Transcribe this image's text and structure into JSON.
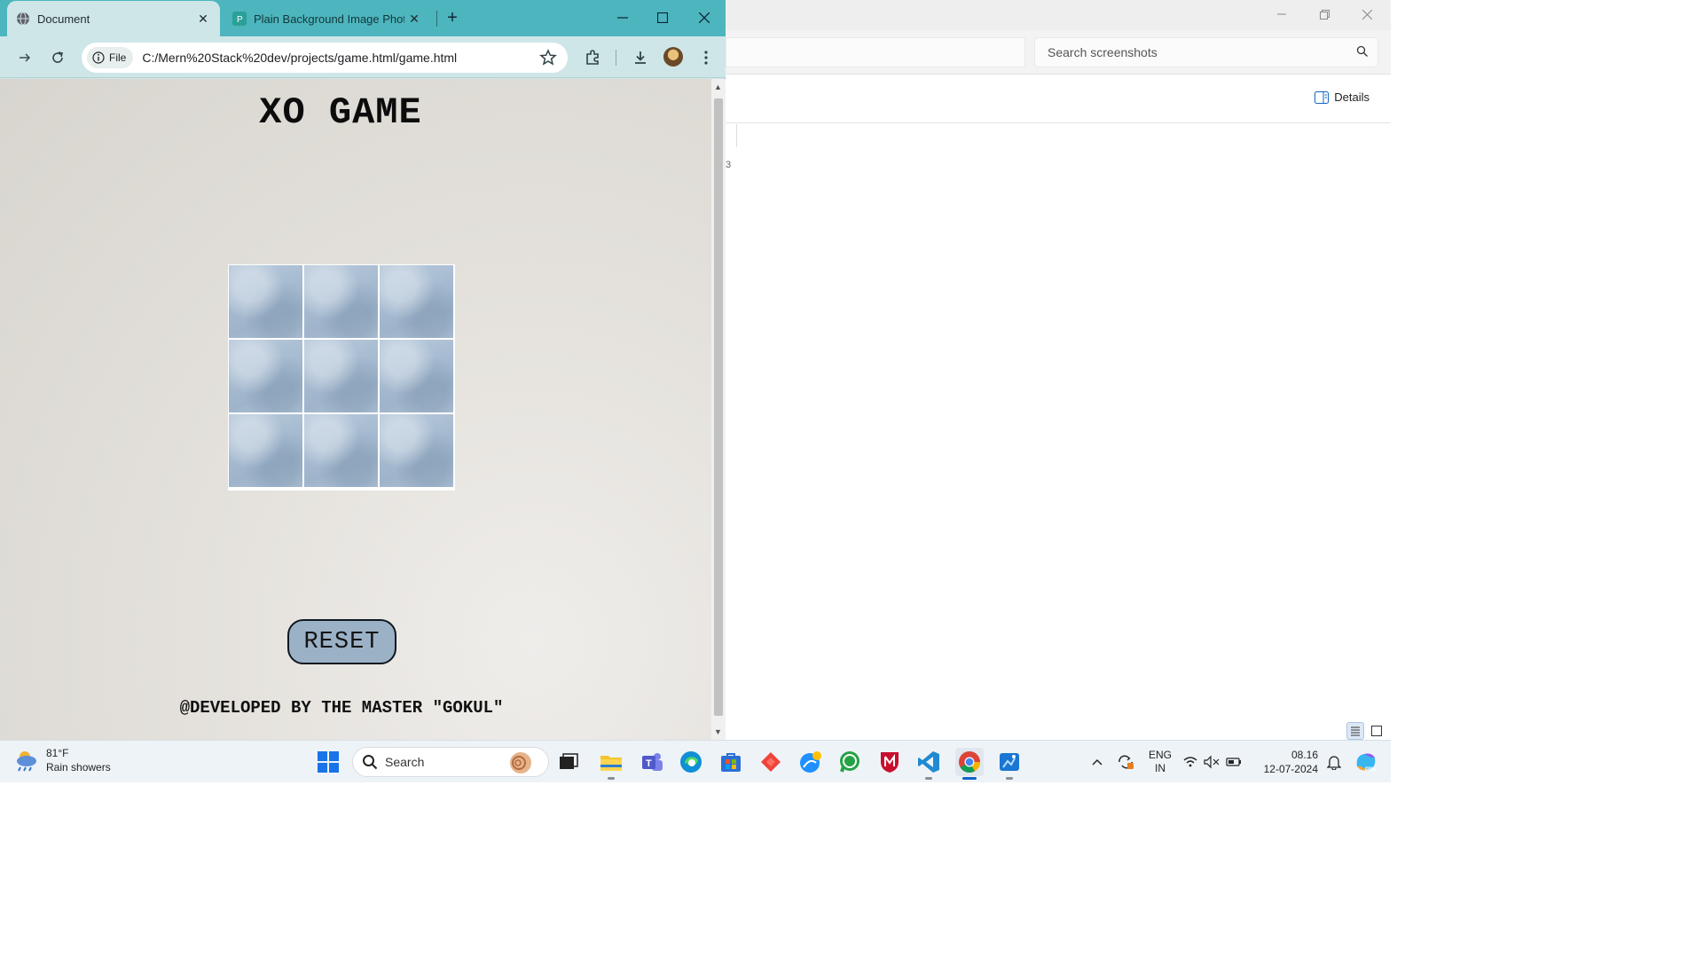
{
  "explorer": {
    "search_placeholder": "Search screenshots",
    "details_label": "Details",
    "stray_char": "3",
    "window_buttons": [
      "minimize",
      "restore",
      "close"
    ]
  },
  "browser": {
    "tabs": [
      {
        "title": "Document",
        "icon": "globe-icon",
        "active": true
      },
      {
        "title": "Plain Background Image Photos",
        "icon": "p-favicon-icon",
        "active": false
      }
    ],
    "omnibox": {
      "chip_label": "File",
      "url": "C:/Mern%20Stack%20dev/projects/game.html/game.html"
    }
  },
  "page": {
    "title": "XO GAME",
    "reset_label": "RESET",
    "footer": "@DEVELOPED BY THE MASTER \"GOKUL\"",
    "cells": [
      "",
      "",
      "",
      "",
      "",
      "",
      "",
      "",
      ""
    ]
  },
  "taskbar": {
    "weather": {
      "temp": "81°F",
      "condition": "Rain showers"
    },
    "search_label": "Search",
    "lang": {
      "line1": "ENG",
      "line2": "IN"
    },
    "clock": {
      "time": "08.16",
      "date": "12-07-2024"
    },
    "pinned": [
      "start-icon",
      "search-box",
      "task-view-icon",
      "file-explorer-icon",
      "teams-icon",
      "edge-icon",
      "store-icon",
      "anydesk-icon",
      "photos-icon",
      "whatsapp-icon",
      "mcafee-icon",
      "vscode-icon",
      "chrome-icon",
      "paint-icon"
    ],
    "colors": {
      "start": "#1a73e8",
      "edge": "#0f8fd6",
      "vscode": "#1f8ad2",
      "whatsapp": "#25a244"
    }
  }
}
